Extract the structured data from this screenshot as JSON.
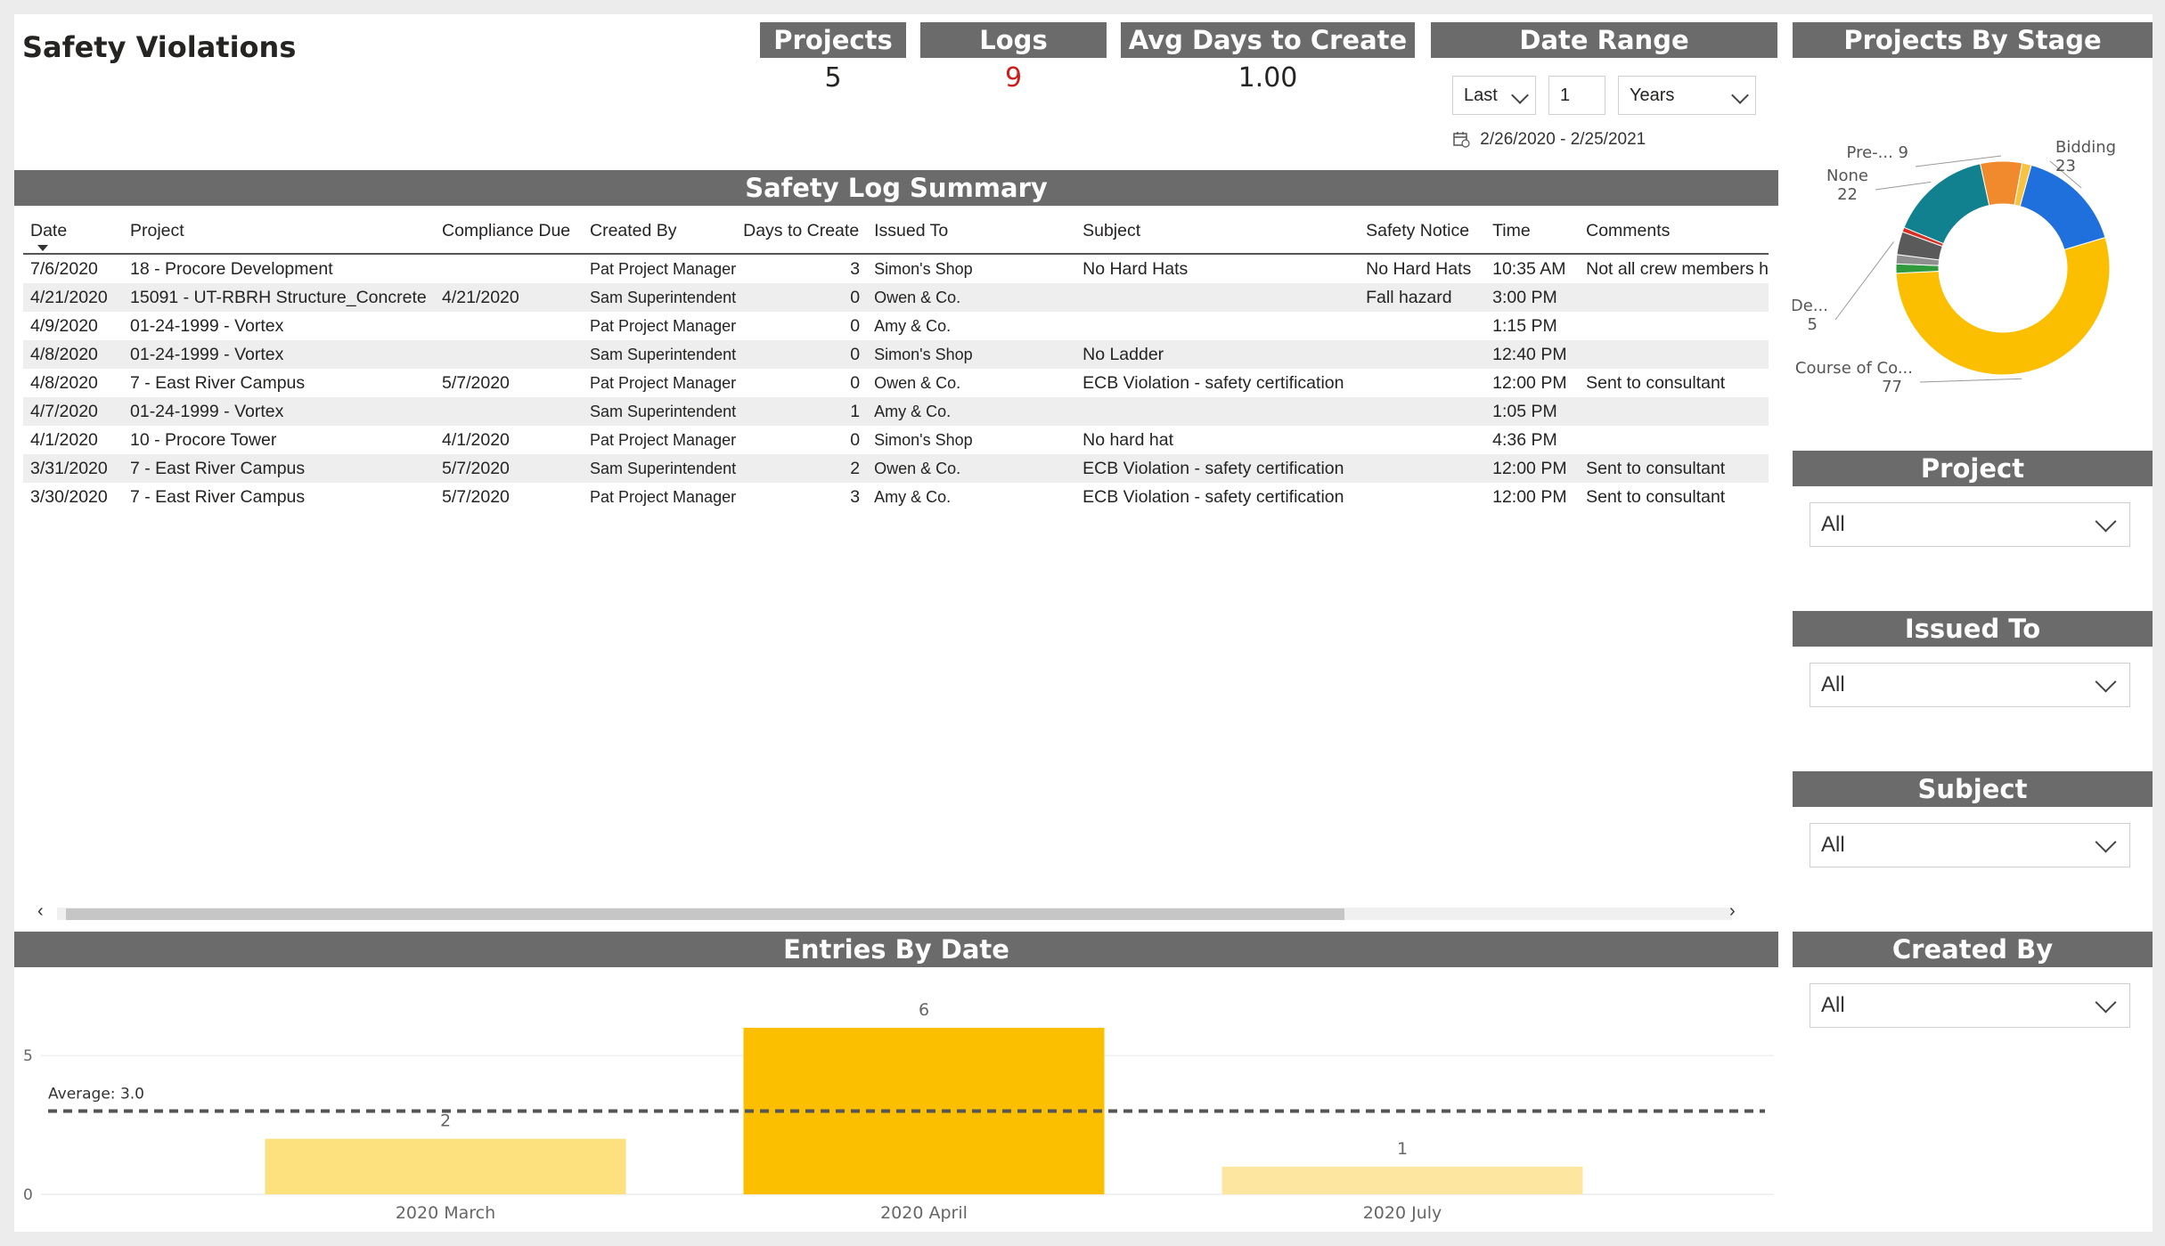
{
  "page_title": "Safety Violations",
  "cards": {
    "projects": {
      "label": "Projects",
      "value": "5"
    },
    "logs": {
      "label": "Logs",
      "value": "9"
    },
    "avg_days": {
      "label": "Avg Days to Create",
      "value": "1.00"
    }
  },
  "date_range": {
    "label": "Date Range",
    "relative": "Last",
    "count": "1",
    "unit": "Years",
    "range_text": "2/26/2020 - 2/25/2021"
  },
  "summary": {
    "title": "Safety Log Summary",
    "columns": [
      "Date",
      "Project",
      "Compliance Due",
      "Created By",
      "Days to Create",
      "Issued To",
      "Subject",
      "Safety Notice",
      "Time",
      "Comments"
    ],
    "rows": [
      [
        "7/6/2020",
        "18 - Procore Development",
        "",
        "Pat Project Manager",
        "3",
        "Simon's Shop",
        "No Hard Hats",
        "No Hard Hats",
        "10:35 AM",
        "Not all crew members h"
      ],
      [
        "4/21/2020",
        "15091 - UT-RBRH Structure_Concrete",
        "4/21/2020",
        "Sam Superintendent",
        "0",
        "Owen & Co.",
        "",
        "Fall hazard",
        "3:00 PM",
        ""
      ],
      [
        "4/9/2020",
        "01-24-1999 - Vortex",
        "",
        "Pat Project Manager",
        "0",
        "Amy & Co.",
        "",
        "",
        "1:15 PM",
        ""
      ],
      [
        "4/8/2020",
        "01-24-1999 - Vortex",
        "",
        "Sam Superintendent",
        "0",
        "Simon's Shop",
        "No Ladder",
        "",
        "12:40 PM",
        ""
      ],
      [
        "4/8/2020",
        "7 - East River Campus",
        "5/7/2020",
        "Pat Project Manager",
        "0",
        "Owen & Co.",
        "ECB Violation - safety certification",
        "",
        "12:00 PM",
        "Sent to consultant"
      ],
      [
        "4/7/2020",
        "01-24-1999 - Vortex",
        "",
        "Sam Superintendent",
        "1",
        "Amy & Co.",
        "",
        "",
        "1:05 PM",
        ""
      ],
      [
        "4/1/2020",
        "10 - Procore Tower",
        "4/1/2020",
        "Pat Project Manager",
        "0",
        "Simon's Shop",
        "No hard hat",
        "",
        "4:36 PM",
        ""
      ],
      [
        "3/31/2020",
        "7 - East River Campus",
        "5/7/2020",
        "Sam Superintendent",
        "2",
        "Owen & Co.",
        "ECB Violation - safety certification",
        "",
        "12:00 PM",
        "Sent to consultant"
      ],
      [
        "3/30/2020",
        "7 - East River Campus",
        "5/7/2020",
        "Pat Project Manager",
        "3",
        "Amy & Co.",
        "ECB Violation - safety certification",
        "",
        "12:00 PM",
        "Sent to consultant"
      ]
    ]
  },
  "entries": {
    "title": "Entries By Date",
    "avg_label": "Average: 3.0"
  },
  "stage": {
    "title": "Projects By Stage"
  },
  "slicers": [
    {
      "title": "Project",
      "value": "All"
    },
    {
      "title": "Issued To",
      "value": "All"
    },
    {
      "title": "Subject",
      "value": "All"
    },
    {
      "title": "Created By",
      "value": "All"
    }
  ],
  "chart_data": [
    {
      "type": "bar",
      "title": "Entries By Date",
      "categories": [
        "2020 March",
        "2020 April",
        "2020 July"
      ],
      "values": [
        2,
        6,
        1
      ],
      "average": 3.0,
      "ylim": [
        0,
        6
      ],
      "yticks": [
        0,
        5
      ],
      "colors": [
        "#fde17e",
        "#fbbf00",
        "#fde7a0"
      ]
    },
    {
      "type": "pie",
      "title": "Projects By Stage",
      "donut": true,
      "slices": [
        {
          "label": "Bidding",
          "value": 23,
          "color": "#1f6fdc"
        },
        {
          "label": "Course of Co...",
          "value": 77,
          "color": "#fbbf00"
        },
        {
          "label": "",
          "value": 2,
          "color": "#2f9b3c"
        },
        {
          "label": "",
          "value": 2,
          "color": "#8f8f8f"
        },
        {
          "label": "De...",
          "value": 5,
          "color": "#5a5a5a"
        },
        {
          "label": "",
          "value": 1,
          "color": "#d93025"
        },
        {
          "label": "None",
          "value": 22,
          "color": "#12818f"
        },
        {
          "label": "Pre-... 9",
          "value": 9,
          "color": "#f08a2c"
        },
        {
          "label": "",
          "value": 2,
          "color": "#f6c343"
        }
      ]
    }
  ]
}
